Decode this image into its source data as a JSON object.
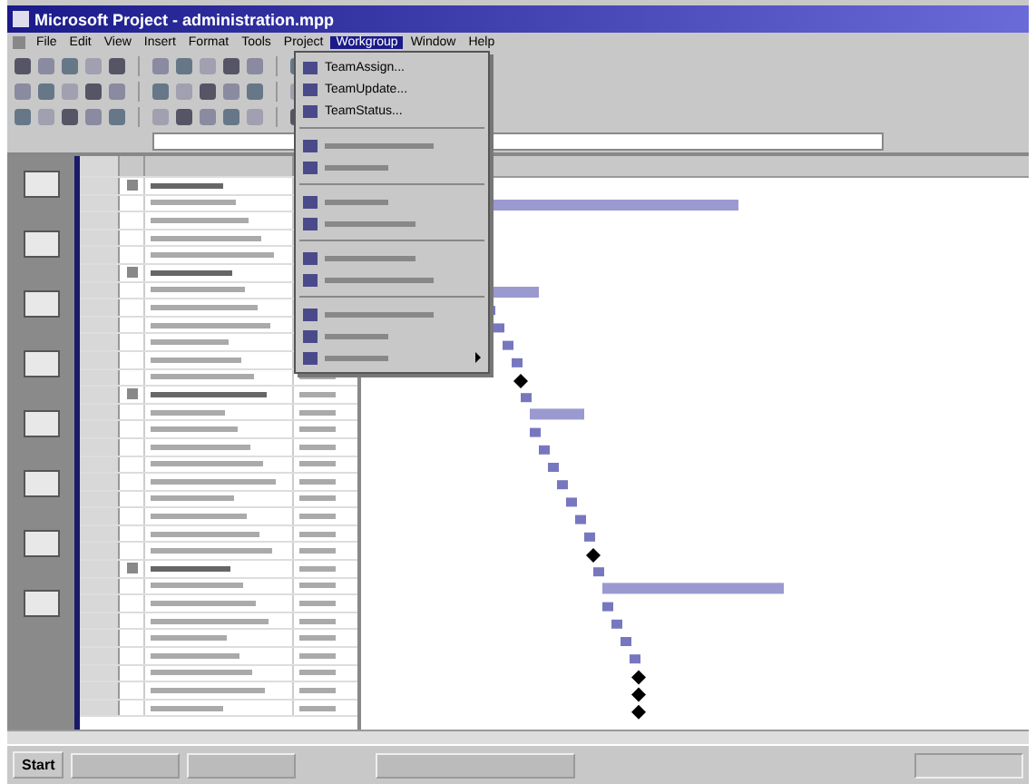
{
  "window": {
    "title": "Microsoft Project - administration.mpp"
  },
  "menu_bar": [
    {
      "label": "File",
      "selected": false
    },
    {
      "label": "Edit",
      "selected": false
    },
    {
      "label": "View",
      "selected": false
    },
    {
      "label": "Insert",
      "selected": false
    },
    {
      "label": "Format",
      "selected": false
    },
    {
      "label": "Tools",
      "selected": false
    },
    {
      "label": "Project",
      "selected": false
    },
    {
      "label": "Workgroup",
      "selected": true
    },
    {
      "label": "Window",
      "selected": false
    },
    {
      "label": "Help",
      "selected": false
    }
  ],
  "dropdown": {
    "groups": [
      [
        {
          "kind": "text",
          "label": "TeamAssign..."
        },
        {
          "kind": "text",
          "label": "TeamUpdate..."
        },
        {
          "kind": "text",
          "label": "TeamStatus..."
        }
      ],
      [
        {
          "kind": "blurred"
        },
        {
          "kind": "blurred"
        }
      ],
      [
        {
          "kind": "blurred"
        },
        {
          "kind": "blurred"
        }
      ],
      [
        {
          "kind": "blurred"
        },
        {
          "kind": "blurred"
        }
      ],
      [
        {
          "kind": "blurred"
        },
        {
          "kind": "blurred"
        },
        {
          "kind": "submenu"
        }
      ]
    ]
  },
  "table": {
    "rows": [
      {
        "kind": "summary"
      },
      {
        "kind": "task"
      },
      {
        "kind": "task"
      },
      {
        "kind": "task"
      },
      {
        "kind": "task"
      },
      {
        "kind": "summary"
      },
      {
        "kind": "task"
      },
      {
        "kind": "task"
      },
      {
        "kind": "task"
      },
      {
        "kind": "task"
      },
      {
        "kind": "milestone"
      },
      {
        "kind": "task"
      },
      {
        "kind": "summary"
      },
      {
        "kind": "task"
      },
      {
        "kind": "task"
      },
      {
        "kind": "task"
      },
      {
        "kind": "task"
      },
      {
        "kind": "task"
      },
      {
        "kind": "task"
      },
      {
        "kind": "task"
      },
      {
        "kind": "milestone"
      },
      {
        "kind": "task"
      },
      {
        "kind": "summary"
      },
      {
        "kind": "task"
      },
      {
        "kind": "task"
      },
      {
        "kind": "task"
      },
      {
        "kind": "task"
      },
      {
        "kind": "milestone"
      },
      {
        "kind": "milestone"
      },
      {
        "kind": "milestone"
      },
      {
        "kind": "task"
      }
    ]
  },
  "taskbar": {
    "start": "Start"
  }
}
